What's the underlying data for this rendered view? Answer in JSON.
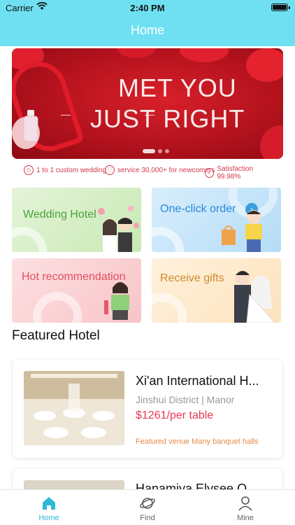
{
  "status_bar": {
    "carrier": "Carrier",
    "time": "2:40 PM"
  },
  "nav": {
    "title": "Home"
  },
  "banner": {
    "line1": "MET YOU",
    "line2": "JUST RIGHT",
    "slide_count": 3,
    "active_slide": 1
  },
  "features": [
    {
      "icon": "diamond-icon",
      "label": "1 to 1 custom wedding"
    },
    {
      "icon": "heart-icon",
      "label": "service 30,000+ for newcomers"
    },
    {
      "icon": "thumbs-up-icon",
      "label": "Satisfaction 99.98%"
    }
  ],
  "tiles": [
    {
      "label": "Wedding Hotel"
    },
    {
      "label": "One-click order"
    },
    {
      "label": "Hot recommendation"
    },
    {
      "label": "Receive gifts"
    }
  ],
  "section": {
    "title": "Featured Hotel"
  },
  "hotels": [
    {
      "name": "Xi'an International H...",
      "location": "Jinshui District | Manor",
      "price": "$1261/per table",
      "tagline": "Featured venue Many banquet halls"
    },
    {
      "name": "Hanamiya Elysee O..."
    }
  ],
  "tabbar": {
    "items": [
      {
        "label": "Home",
        "icon": "home-icon",
        "active": true
      },
      {
        "label": "Find",
        "icon": "planet-icon",
        "active": false
      },
      {
        "label": "Mine",
        "icon": "user-icon",
        "active": false
      }
    ]
  },
  "colors": {
    "nav": "#6fe0f2",
    "accent": "#2fb7d8",
    "price": "#e53950"
  }
}
